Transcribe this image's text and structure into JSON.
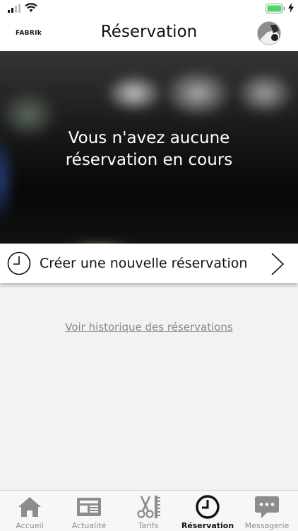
{
  "header": {
    "brand": "FABRIk",
    "title": "Réservation"
  },
  "hero": {
    "message": "Vous n'avez aucune réservation en cours",
    "message_line1": "Vous n'avez aucune",
    "message_line2": "réservation en cours"
  },
  "create_reservation": {
    "label": "Créer une nouvelle réservation",
    "icon": "clock-icon"
  },
  "history_link": {
    "label": "Voir historique des réservations"
  },
  "tabs": [
    {
      "label": "Accueil",
      "icon": "home-icon",
      "active": false
    },
    {
      "label": "Actualité",
      "icon": "newspaper-icon",
      "active": false
    },
    {
      "label": "Tarifs",
      "icon": "scissors-comb-icon",
      "active": false
    },
    {
      "label": "Réservation",
      "icon": "clock-icon",
      "active": true
    },
    {
      "label": "Messagerie",
      "icon": "chat-icon",
      "active": false
    }
  ],
  "colors": {
    "battery": "#4cd964",
    "tab_inactive": "#8c8c8c",
    "tab_active": "#111111",
    "link": "#8a8a8a"
  }
}
